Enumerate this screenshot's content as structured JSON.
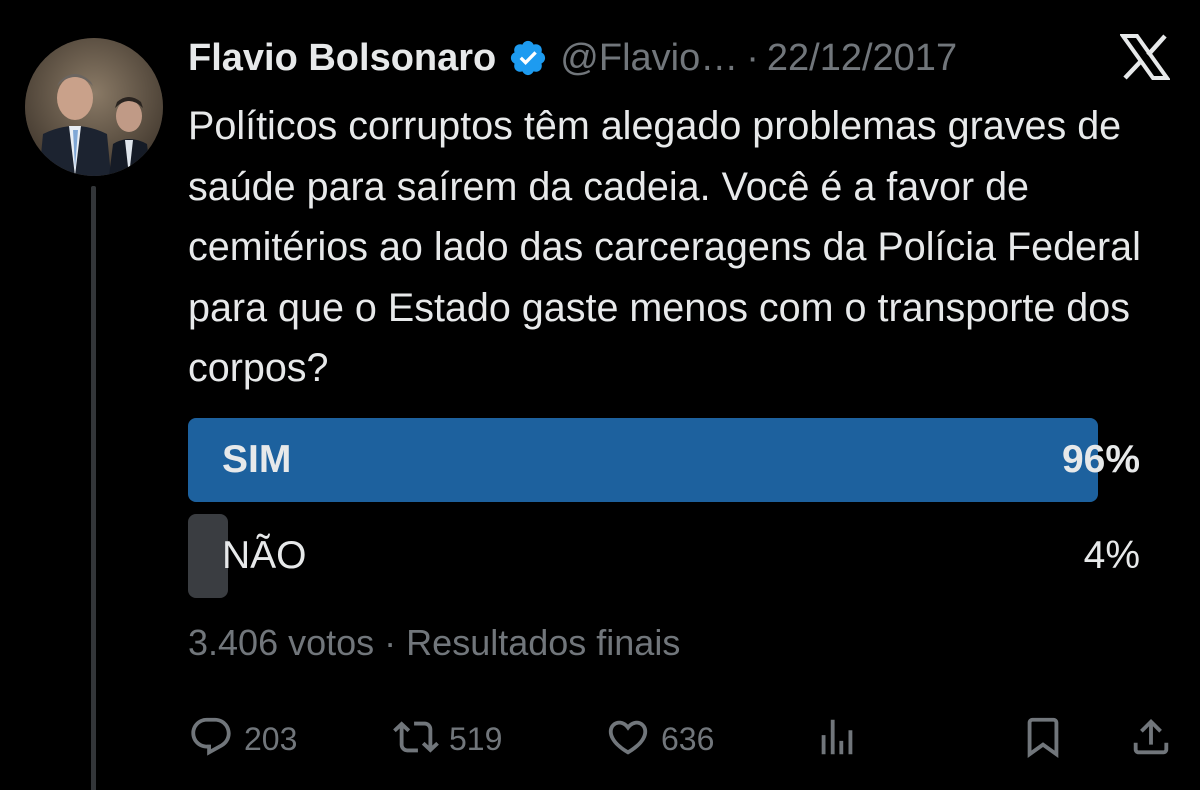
{
  "tweet": {
    "author_name": "Flavio Bolsonaro",
    "handle": "@Flavio…",
    "separator": "·",
    "date": "22/12/2017",
    "text": "Políticos corruptos têm alegado problemas graves de saúde para saírem da cadeia. Você é a favor de cemitérios ao lado das carceragens da Polícia Federal para que o Estado gaste menos com o transporte dos corpos?"
  },
  "poll": {
    "options": [
      {
        "label": "SIM",
        "percent_text": "96%",
        "percent": 96,
        "winner": true
      },
      {
        "label": "NÃO",
        "percent_text": "4%",
        "percent": 4,
        "winner": false
      }
    ],
    "votes": "3.406 votos",
    "separator": "·",
    "status": "Resultados finais"
  },
  "actions": {
    "replies": "203",
    "reposts": "519",
    "likes": "636"
  },
  "icons": [
    "verified-badge-icon",
    "x-logo-icon",
    "reply-icon",
    "repost-icon",
    "like-icon",
    "views-icon",
    "bookmark-icon",
    "share-icon"
  ],
  "colors": {
    "background": "#000000",
    "text": "#e7e9ea",
    "muted": "#71767b",
    "verified": "#1d9bf0",
    "poll_winner": "#1d619e",
    "poll_other": "#3a3d41"
  }
}
